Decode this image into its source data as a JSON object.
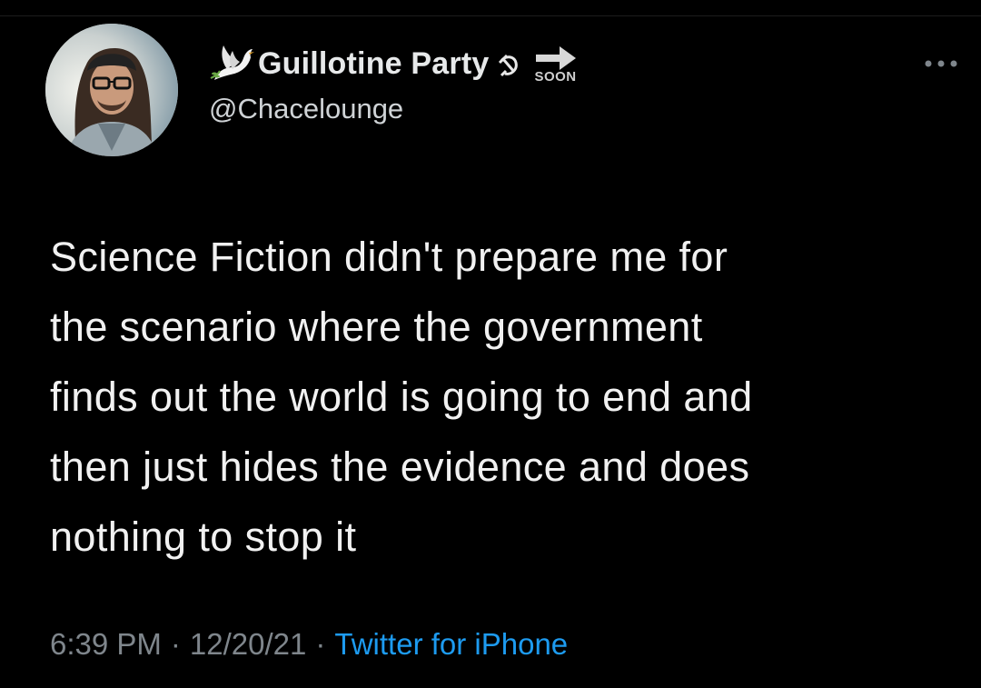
{
  "tweet": {
    "author": {
      "display_name": "Guillotine Party",
      "handle": "@Chacelounge",
      "name_emoji": [
        "dove-icon",
        "hammer-sickle-icon"
      ],
      "soon_sign_text": "SOON"
    },
    "text": "Science Fiction didn't prepare me for\nthe scenario where the government\nfinds out the world is going to end and\nthen just hides the evidence and does\nnothing to stop it",
    "time": "6:39 PM",
    "date": "12/20/21",
    "separator": "·",
    "source": "Twitter for iPhone",
    "colors": {
      "background": "#000000",
      "text": "#e7e9ea",
      "muted": "#7f868c",
      "link": "#1d9bf0"
    }
  }
}
